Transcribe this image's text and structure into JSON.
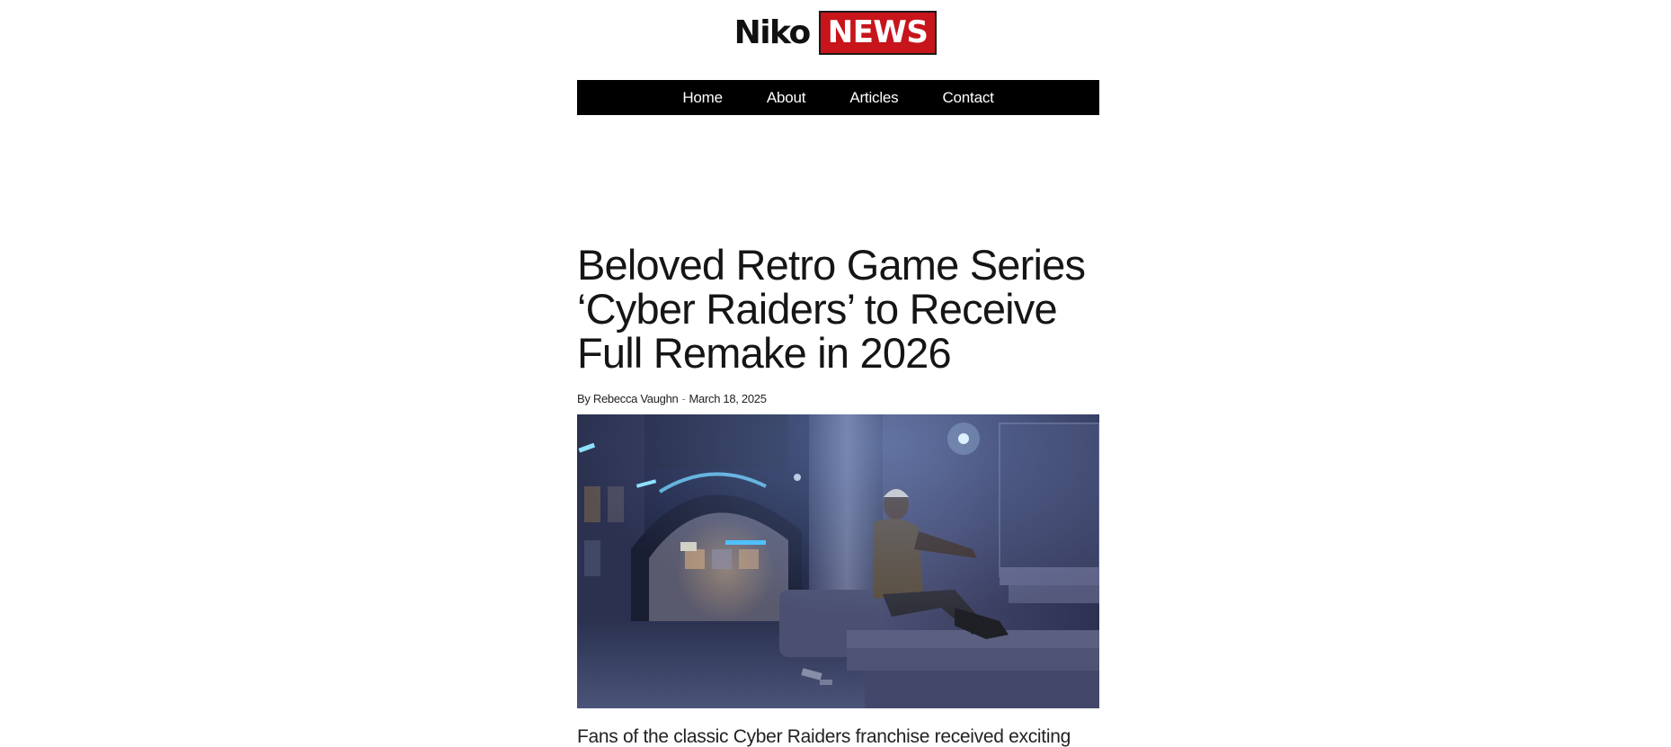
{
  "logo": {
    "part1": "Niko",
    "part2": "NEWS",
    "accent_color": "#c8141b"
  },
  "nav": {
    "items": [
      {
        "label": "Home"
      },
      {
        "label": "About"
      },
      {
        "label": "Articles"
      },
      {
        "label": "Contact"
      }
    ]
  },
  "article": {
    "title": "Beloved Retro Game Series ‘Cyber Raiders’ to Receive Full Remake in 2026",
    "author": "By Rebecca Vaughn",
    "separator": "-",
    "date": "March 18, 2025",
    "image_alt": "cyberpunk-alley-character-image",
    "lede": "Fans of the classic Cyber Raiders franchise received exciting"
  }
}
